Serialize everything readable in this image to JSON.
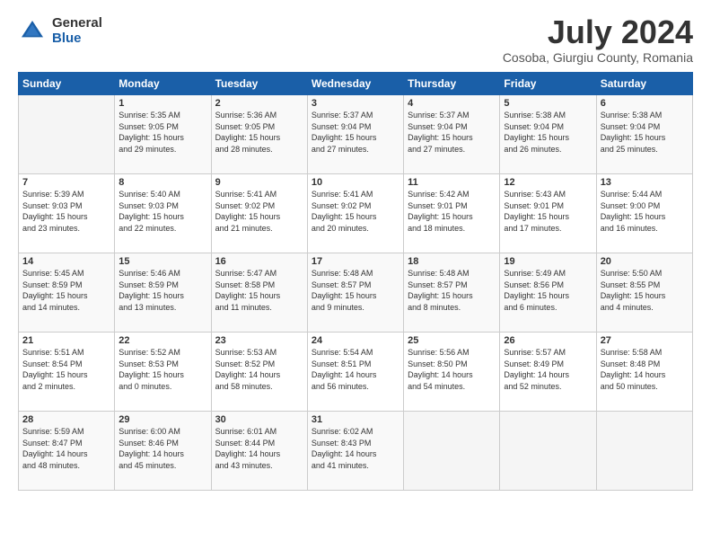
{
  "logo": {
    "general": "General",
    "blue": "Blue"
  },
  "title": "July 2024",
  "subtitle": "Cosoba, Giurgiu County, Romania",
  "weekdays": [
    "Sunday",
    "Monday",
    "Tuesday",
    "Wednesday",
    "Thursday",
    "Friday",
    "Saturday"
  ],
  "weeks": [
    [
      {
        "day": "",
        "info": ""
      },
      {
        "day": "1",
        "info": "Sunrise: 5:35 AM\nSunset: 9:05 PM\nDaylight: 15 hours\nand 29 minutes."
      },
      {
        "day": "2",
        "info": "Sunrise: 5:36 AM\nSunset: 9:05 PM\nDaylight: 15 hours\nand 28 minutes."
      },
      {
        "day": "3",
        "info": "Sunrise: 5:37 AM\nSunset: 9:04 PM\nDaylight: 15 hours\nand 27 minutes."
      },
      {
        "day": "4",
        "info": "Sunrise: 5:37 AM\nSunset: 9:04 PM\nDaylight: 15 hours\nand 27 minutes."
      },
      {
        "day": "5",
        "info": "Sunrise: 5:38 AM\nSunset: 9:04 PM\nDaylight: 15 hours\nand 26 minutes."
      },
      {
        "day": "6",
        "info": "Sunrise: 5:38 AM\nSunset: 9:04 PM\nDaylight: 15 hours\nand 25 minutes."
      }
    ],
    [
      {
        "day": "7",
        "info": "Sunrise: 5:39 AM\nSunset: 9:03 PM\nDaylight: 15 hours\nand 23 minutes."
      },
      {
        "day": "8",
        "info": "Sunrise: 5:40 AM\nSunset: 9:03 PM\nDaylight: 15 hours\nand 22 minutes."
      },
      {
        "day": "9",
        "info": "Sunrise: 5:41 AM\nSunset: 9:02 PM\nDaylight: 15 hours\nand 21 minutes."
      },
      {
        "day": "10",
        "info": "Sunrise: 5:41 AM\nSunset: 9:02 PM\nDaylight: 15 hours\nand 20 minutes."
      },
      {
        "day": "11",
        "info": "Sunrise: 5:42 AM\nSunset: 9:01 PM\nDaylight: 15 hours\nand 18 minutes."
      },
      {
        "day": "12",
        "info": "Sunrise: 5:43 AM\nSunset: 9:01 PM\nDaylight: 15 hours\nand 17 minutes."
      },
      {
        "day": "13",
        "info": "Sunrise: 5:44 AM\nSunset: 9:00 PM\nDaylight: 15 hours\nand 16 minutes."
      }
    ],
    [
      {
        "day": "14",
        "info": "Sunrise: 5:45 AM\nSunset: 8:59 PM\nDaylight: 15 hours\nand 14 minutes."
      },
      {
        "day": "15",
        "info": "Sunrise: 5:46 AM\nSunset: 8:59 PM\nDaylight: 15 hours\nand 13 minutes."
      },
      {
        "day": "16",
        "info": "Sunrise: 5:47 AM\nSunset: 8:58 PM\nDaylight: 15 hours\nand 11 minutes."
      },
      {
        "day": "17",
        "info": "Sunrise: 5:48 AM\nSunset: 8:57 PM\nDaylight: 15 hours\nand 9 minutes."
      },
      {
        "day": "18",
        "info": "Sunrise: 5:48 AM\nSunset: 8:57 PM\nDaylight: 15 hours\nand 8 minutes."
      },
      {
        "day": "19",
        "info": "Sunrise: 5:49 AM\nSunset: 8:56 PM\nDaylight: 15 hours\nand 6 minutes."
      },
      {
        "day": "20",
        "info": "Sunrise: 5:50 AM\nSunset: 8:55 PM\nDaylight: 15 hours\nand 4 minutes."
      }
    ],
    [
      {
        "day": "21",
        "info": "Sunrise: 5:51 AM\nSunset: 8:54 PM\nDaylight: 15 hours\nand 2 minutes."
      },
      {
        "day": "22",
        "info": "Sunrise: 5:52 AM\nSunset: 8:53 PM\nDaylight: 15 hours\nand 0 minutes."
      },
      {
        "day": "23",
        "info": "Sunrise: 5:53 AM\nSunset: 8:52 PM\nDaylight: 14 hours\nand 58 minutes."
      },
      {
        "day": "24",
        "info": "Sunrise: 5:54 AM\nSunset: 8:51 PM\nDaylight: 14 hours\nand 56 minutes."
      },
      {
        "day": "25",
        "info": "Sunrise: 5:56 AM\nSunset: 8:50 PM\nDaylight: 14 hours\nand 54 minutes."
      },
      {
        "day": "26",
        "info": "Sunrise: 5:57 AM\nSunset: 8:49 PM\nDaylight: 14 hours\nand 52 minutes."
      },
      {
        "day": "27",
        "info": "Sunrise: 5:58 AM\nSunset: 8:48 PM\nDaylight: 14 hours\nand 50 minutes."
      }
    ],
    [
      {
        "day": "28",
        "info": "Sunrise: 5:59 AM\nSunset: 8:47 PM\nDaylight: 14 hours\nand 48 minutes."
      },
      {
        "day": "29",
        "info": "Sunrise: 6:00 AM\nSunset: 8:46 PM\nDaylight: 14 hours\nand 45 minutes."
      },
      {
        "day": "30",
        "info": "Sunrise: 6:01 AM\nSunset: 8:44 PM\nDaylight: 14 hours\nand 43 minutes."
      },
      {
        "day": "31",
        "info": "Sunrise: 6:02 AM\nSunset: 8:43 PM\nDaylight: 14 hours\nand 41 minutes."
      },
      {
        "day": "",
        "info": ""
      },
      {
        "day": "",
        "info": ""
      },
      {
        "day": "",
        "info": ""
      }
    ]
  ]
}
